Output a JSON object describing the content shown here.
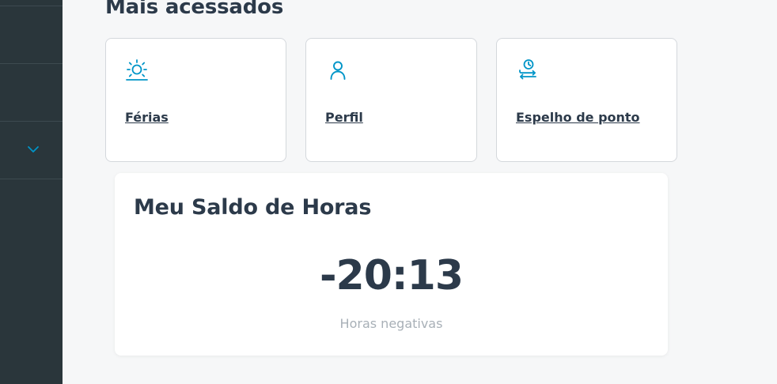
{
  "colors": {
    "sidebar_background": "#2a363b",
    "page_background": "#f6f7f8",
    "accent_icon": "#0095c8",
    "text_primary": "#2c3a4a",
    "text_muted": "#a8b0b7"
  },
  "sidebar": {
    "expand_icon": "chevron-down-icon"
  },
  "section": {
    "title": "Mais acessados"
  },
  "shortcuts": [
    {
      "label": "Férias",
      "icon": "sun-icon"
    },
    {
      "label": "Perfil",
      "icon": "user-icon"
    },
    {
      "label": "Espelho de ponto",
      "icon": "time-clock-icon"
    }
  ],
  "balance": {
    "title": "Meu Saldo de Horas",
    "value": "-20:13",
    "caption": "Horas negativas"
  }
}
